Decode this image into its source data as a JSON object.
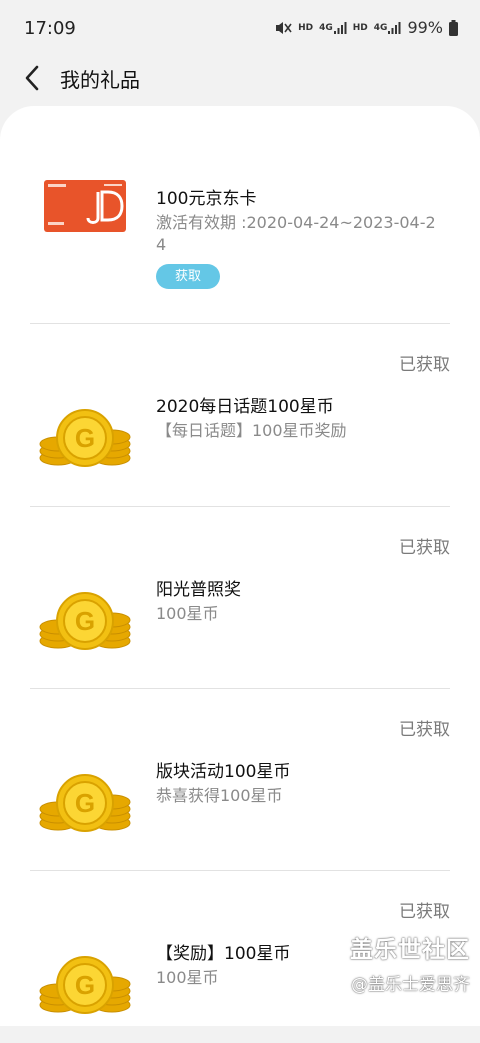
{
  "status_bar": {
    "time": "17:09",
    "hd1": "HD",
    "net1": "4G",
    "hd2": "HD",
    "net2": "4G",
    "battery": "99%"
  },
  "header": {
    "title": "我的礼品"
  },
  "gifts": [
    {
      "name": "100元京东卡",
      "desc": "激活有效期 :2020-04-24~2023-04-24",
      "action": "获取",
      "icon": "jd-card-icon"
    },
    {
      "name": "2020每日话题100星币",
      "desc": "【每日话题】100星币奖励",
      "status": "已获取",
      "icon": "coin-stack-icon"
    },
    {
      "name": "阳光普照奖",
      "desc": "100星币",
      "status": "已获取",
      "icon": "coin-stack-icon"
    },
    {
      "name": "版块活动100星币",
      "desc": "恭喜获得100星币",
      "status": "已获取",
      "icon": "coin-stack-icon"
    },
    {
      "name": "【奖励】100星币",
      "desc": "100星币",
      "status": "已获取",
      "icon": "coin-stack-icon"
    }
  ],
  "watermark": {
    "line1": "盖乐世社区",
    "line2": "@盖乐士爱思齐"
  },
  "colors": {
    "claim_button": "#64c7e6",
    "coin": "#f2c012",
    "jd_card": "#e8542a"
  }
}
